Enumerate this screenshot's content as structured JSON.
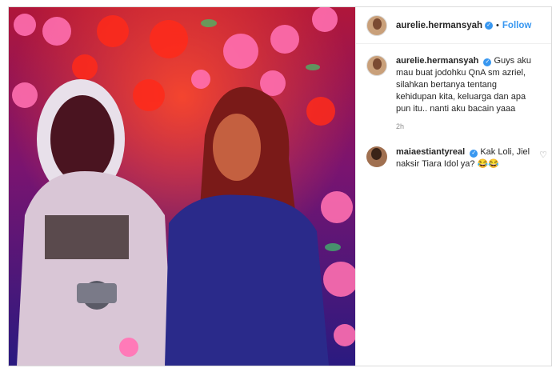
{
  "post": {
    "username": "aurelie.hermansyah",
    "follow_label": "Follow",
    "dot": "•",
    "verified_mark": "✓"
  },
  "caption": {
    "username": "aurelie.hermansyah",
    "text": "Guys aku mau buat jodohku QnA sm azriel, silahkan bertanya tentang kehidupan kita, keluarga dan apa pun itu.. nanti aku bacain yaaa",
    "time": "2h"
  },
  "comments": [
    {
      "username": "maiaestiantyreal",
      "text": "Kak Loli, Jiel naksir Tiara Idol ya? 😂😂"
    }
  ],
  "icons": {
    "verified": "verified-badge-icon",
    "like": "heart-icon"
  },
  "colors": {
    "link": "#3897f0",
    "verified": "#3897f0",
    "text": "#262626",
    "muted": "#8e8e8e"
  }
}
